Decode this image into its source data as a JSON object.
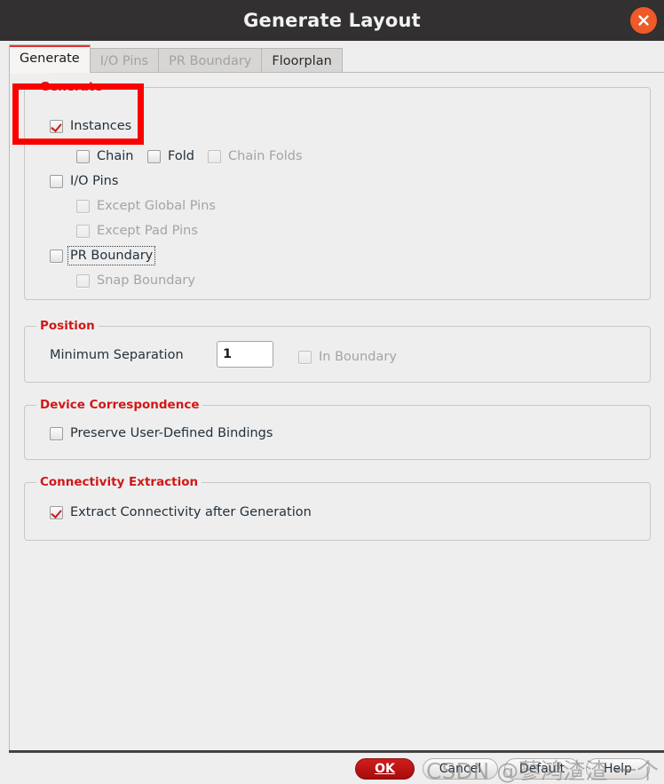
{
  "window": {
    "title": "Generate Layout",
    "close_icon": "close-icon"
  },
  "tabs": [
    {
      "label": "Generate",
      "state": "active"
    },
    {
      "label": "I/O Pins",
      "state": "disabled"
    },
    {
      "label": "PR Boundary",
      "state": "disabled"
    },
    {
      "label": "Floorplan",
      "state": "enabled"
    }
  ],
  "groups": {
    "generate": {
      "title": "Generate",
      "options": [
        {
          "label": "Instances",
          "checked": true,
          "enabled": true,
          "focused": false
        },
        {
          "label": "Chain",
          "checked": false,
          "enabled": true,
          "focused": false
        },
        {
          "label": "Fold",
          "checked": false,
          "enabled": true,
          "focused": false
        },
        {
          "label": "Chain Folds",
          "checked": false,
          "enabled": false,
          "focused": false
        },
        {
          "label": "I/O Pins",
          "checked": false,
          "enabled": true,
          "focused": false
        },
        {
          "label": "Except Global Pins",
          "checked": false,
          "enabled": false,
          "focused": false
        },
        {
          "label": "Except Pad Pins",
          "checked": false,
          "enabled": false,
          "focused": false
        },
        {
          "label": "PR Boundary",
          "checked": false,
          "enabled": true,
          "focused": true
        },
        {
          "label": "Snap Boundary",
          "checked": false,
          "enabled": false,
          "focused": false
        }
      ]
    },
    "position": {
      "title": "Position",
      "min_separation_label": "Minimum Separation",
      "min_separation_value": "1",
      "in_boundary": {
        "label": "In Boundary",
        "checked": false,
        "enabled": false
      }
    },
    "device_correspondence": {
      "title": "Device Correspondence",
      "preserve_bindings": {
        "label": "Preserve User-Defined Bindings",
        "checked": false,
        "enabled": true
      }
    },
    "connectivity_extraction": {
      "title": "Connectivity Extraction",
      "extract_after_generation": {
        "label": "Extract Connectivity after Generation",
        "checked": true,
        "enabled": true
      }
    }
  },
  "buttons": {
    "ok": "OK",
    "cancel": "Cancel",
    "default": "Default",
    "help": "Help"
  },
  "watermark": {
    "text": "CSDN @蓼鸿渣渣 一个"
  },
  "colors": {
    "accent_red": "#d01818",
    "annotation_red": "#fc0000",
    "titlebar": "#323030",
    "close_button": "#ef5a28",
    "ok_button": "#c01818",
    "panel_bg": "#efeeee"
  }
}
